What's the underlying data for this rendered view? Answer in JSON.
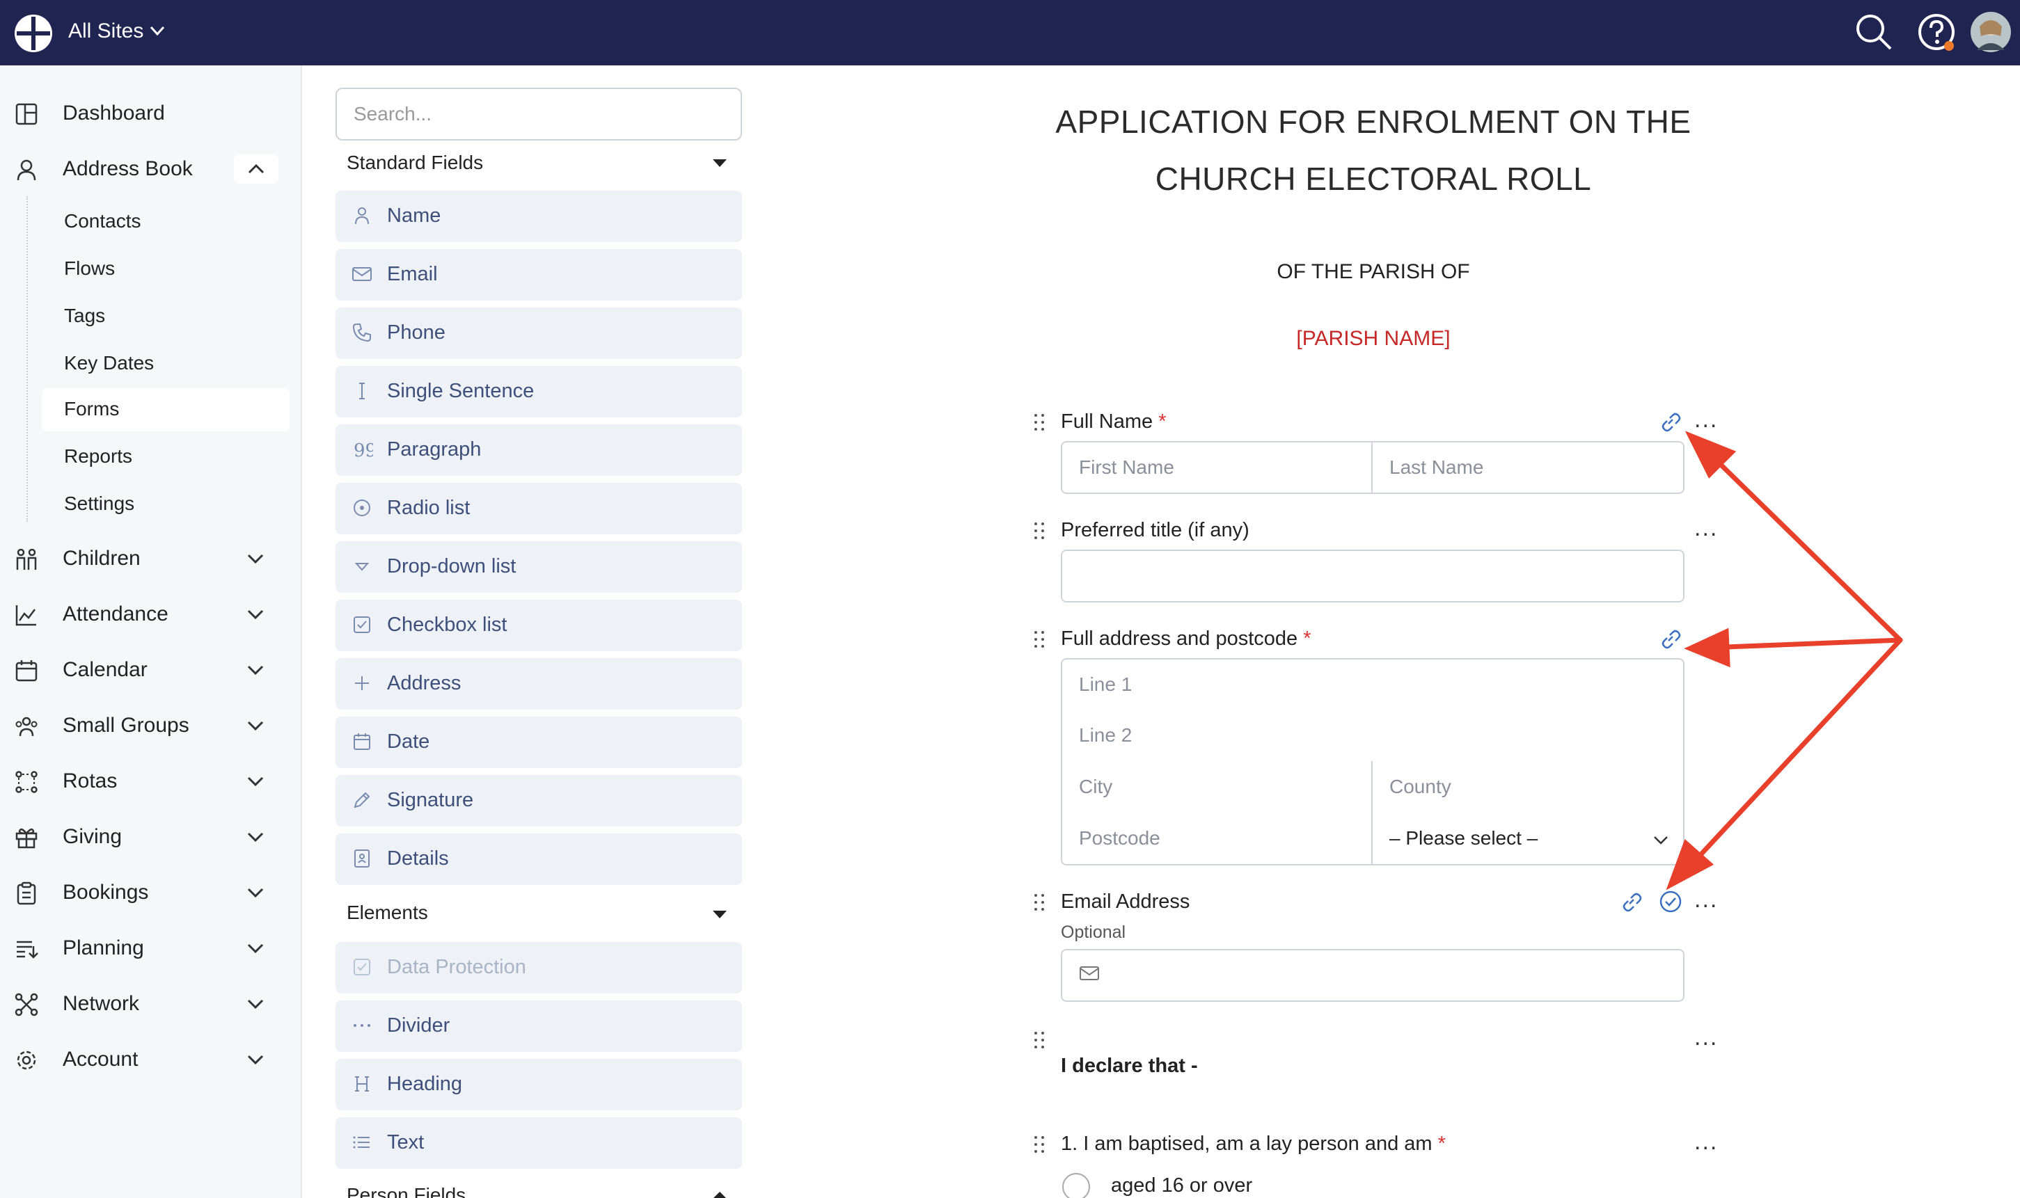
{
  "topbar": {
    "site_selector": "All Sites"
  },
  "sidebar": {
    "items": [
      {
        "label": "Dashboard"
      },
      {
        "label": "Address Book"
      },
      {
        "label": "Children"
      },
      {
        "label": "Attendance"
      },
      {
        "label": "Calendar"
      },
      {
        "label": "Small Groups"
      },
      {
        "label": "Rotas"
      },
      {
        "label": "Giving"
      },
      {
        "label": "Bookings"
      },
      {
        "label": "Planning"
      },
      {
        "label": "Network"
      },
      {
        "label": "Account"
      }
    ],
    "sub_items": [
      {
        "label": "Contacts"
      },
      {
        "label": "Flows"
      },
      {
        "label": "Tags"
      },
      {
        "label": "Key Dates"
      },
      {
        "label": "Forms"
      },
      {
        "label": "Reports"
      },
      {
        "label": "Settings"
      }
    ]
  },
  "fields": {
    "search_placeholder": "Search...",
    "standard_header": "Standard Fields",
    "standard": [
      {
        "label": "Name"
      },
      {
        "label": "Email"
      },
      {
        "label": "Phone"
      },
      {
        "label": "Single Sentence"
      },
      {
        "label": "Paragraph"
      },
      {
        "label": "Radio list"
      },
      {
        "label": "Drop-down list"
      },
      {
        "label": "Checkbox list"
      },
      {
        "label": "Address"
      },
      {
        "label": "Date"
      },
      {
        "label": "Signature"
      },
      {
        "label": "Details"
      }
    ],
    "elements_header": "Elements",
    "elements": [
      {
        "label": "Data Protection"
      },
      {
        "label": "Divider"
      },
      {
        "label": "Heading"
      },
      {
        "label": "Text"
      }
    ],
    "person_header": "Person Fields"
  },
  "form": {
    "title_line1": "APPLICATION FOR ENROLMENT ON THE",
    "title_line2": "CHURCH ELECTORAL ROLL",
    "subtitle": "OF THE PARISH OF",
    "parish": "[PARISH NAME]",
    "full_name_label": "Full Name",
    "required_mark": "*",
    "first_name_placeholder": "First Name",
    "last_name_placeholder": "Last Name",
    "title_label": "Preferred title (if any)",
    "address_label": "Full address and postcode",
    "line1_placeholder": "Line 1",
    "line2_placeholder": "Line 2",
    "city_placeholder": "City",
    "county_placeholder": "County",
    "postcode_placeholder": "Postcode",
    "country_select": "– Please select –",
    "email_label": "Email Address",
    "email_help": "Optional",
    "declare_text": "I declare that -",
    "q1_label": "1. I am baptised, am a lay person and am",
    "q1_option1": "aged 16 or over",
    "more_label": "..."
  },
  "colors": {
    "topbar": "#1f2550",
    "accent_red": "#e8402a",
    "required": "#dd3333",
    "parish_red": "#c62828",
    "tile_bg": "#eef2f7"
  }
}
